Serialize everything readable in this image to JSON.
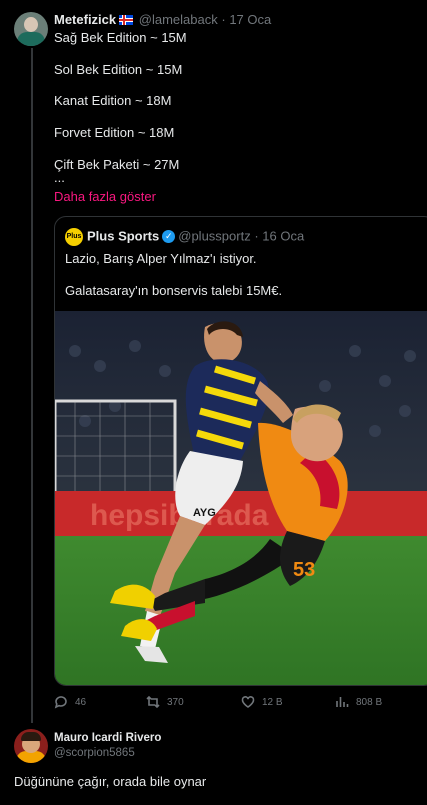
{
  "tweet": {
    "author_name": "Metefizick",
    "author_flag": "iceland-flag",
    "handle": "@lamelaback",
    "separator": "·",
    "date": "17 Oca",
    "lines": [
      "Sağ Bek Edition ~ 15M",
      "Sol Bek Edition ~ 15M",
      "Kanat Edition ~ 18M",
      "Forvet Edition ~ 18M",
      "Çift Bek Paketi ~ 27M",
      "..."
    ],
    "show_more": "Daha fazla göster",
    "show_more_color": "#f91880"
  },
  "quote": {
    "logo_text": "Plus",
    "author_name": "Plus Sports",
    "handle": "@plussportz",
    "separator": "·",
    "date": "16 Oca",
    "line1": "Lazio, Barış Alper Yılmaz'ı istiyor.",
    "line2": "Galatasaray'ın bonservis talebi 15M€.",
    "image": {
      "kit_number": "53",
      "sponsor": "AYG",
      "board_text": "hepsiburada"
    }
  },
  "actions": {
    "replies": "46",
    "retweets": "370",
    "likes": "12 B",
    "views": "808 B"
  },
  "reply": {
    "author_name": "Mauro Icardi Rivero",
    "handle": "@scorpion5865",
    "text": "Düğününe çağır, orada bile oynar"
  }
}
